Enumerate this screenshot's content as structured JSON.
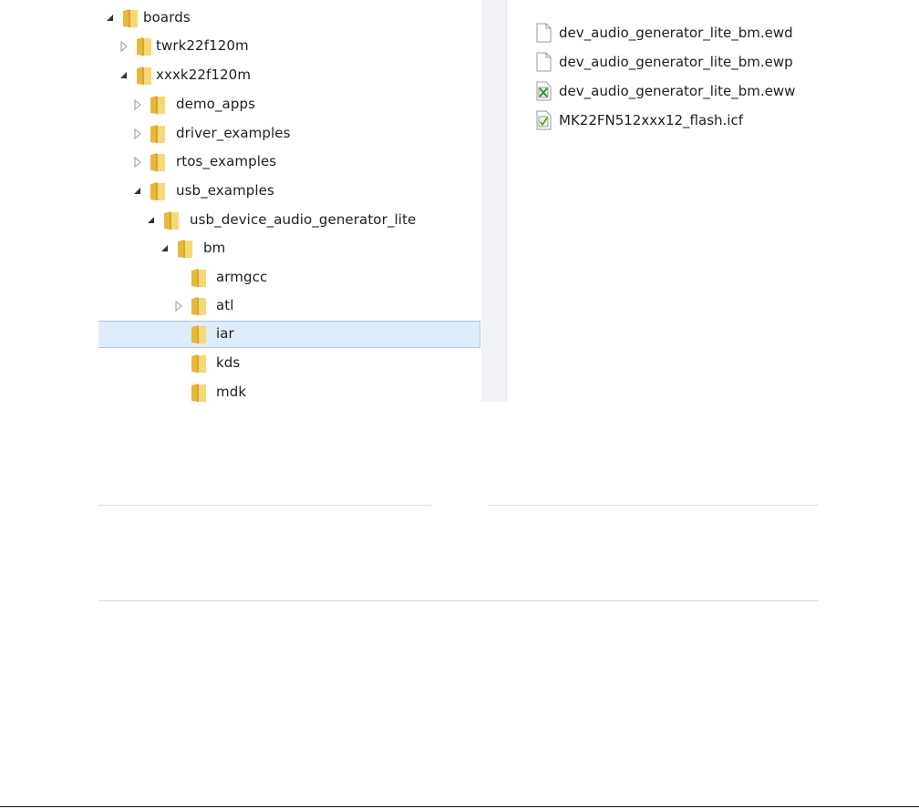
{
  "tree": {
    "items": [
      {
        "label": "boards",
        "expander": "expanded"
      },
      {
        "label": "twrk22f120m",
        "expander": "collapsed"
      },
      {
        "label": "xxxk22f120m",
        "expander": "expanded"
      },
      {
        "label": "demo_apps",
        "expander": "collapsed"
      },
      {
        "label": "driver_examples",
        "expander": "collapsed"
      },
      {
        "label": "rtos_examples",
        "expander": "collapsed"
      },
      {
        "label": "usb_examples",
        "expander": "expanded"
      },
      {
        "label": "usb_device_audio_generator_lite",
        "expander": "expanded"
      },
      {
        "label": "bm",
        "expander": "expanded"
      },
      {
        "label": "armgcc",
        "expander": "none"
      },
      {
        "label": "atl",
        "expander": "collapsed"
      },
      {
        "label": "iar",
        "expander": "none",
        "selected": true
      },
      {
        "label": "kds",
        "expander": "none"
      },
      {
        "label": "mdk",
        "expander": "none"
      }
    ]
  },
  "files": {
    "items": [
      {
        "label": "dev_audio_generator_lite_bm.ewd",
        "icon": "blank-file-icon"
      },
      {
        "label": "dev_audio_generator_lite_bm.ewp",
        "icon": "blank-file-icon"
      },
      {
        "label": "dev_audio_generator_lite_bm.eww",
        "icon": "iar-workspace-file-icon"
      },
      {
        "label": "MK22FN512xxx12_flash.icf",
        "icon": "icf-file-icon"
      }
    ]
  },
  "colors": {
    "selection_bg": "#dfecfb",
    "selection_border": "#a7c8ec",
    "folder_yellow": "#f5cf5b",
    "text": "#1e1e1e"
  }
}
